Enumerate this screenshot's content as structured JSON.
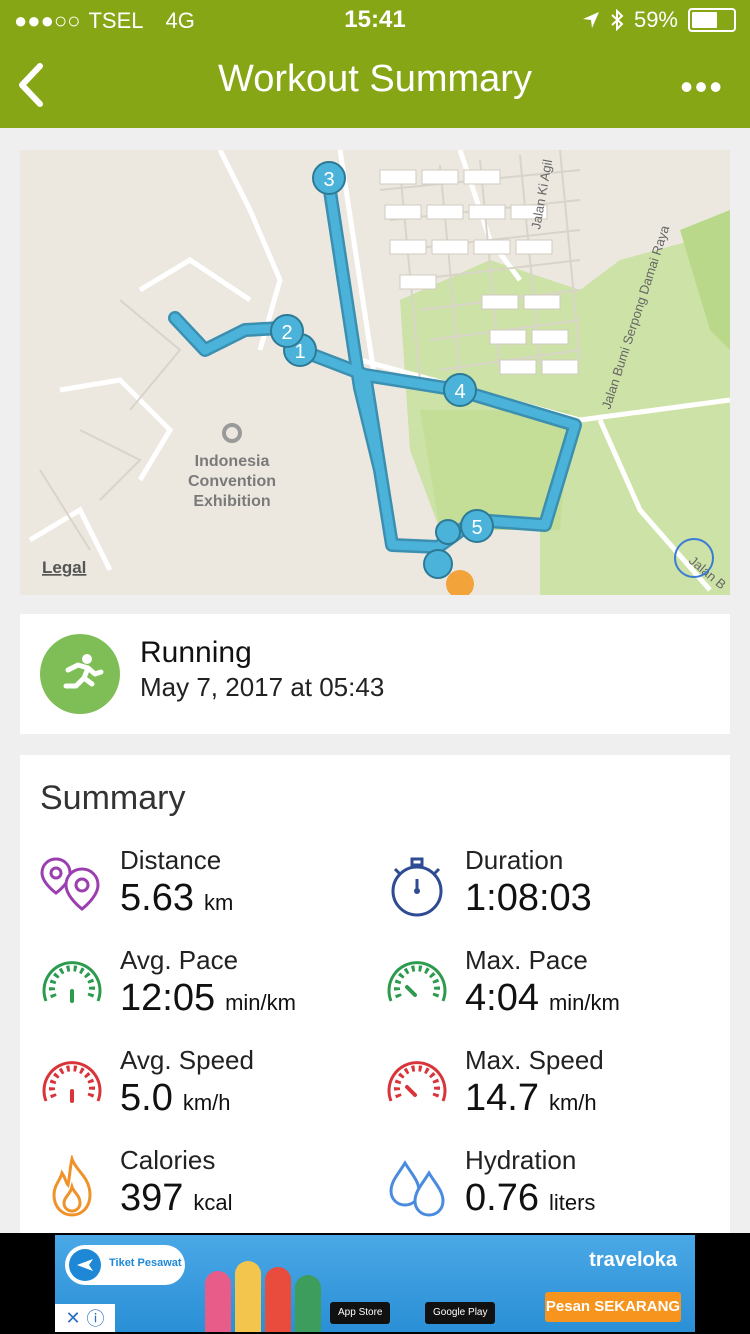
{
  "status_bar": {
    "carrier": "TSEL",
    "network": "4G",
    "time": "15:41",
    "battery": "59%",
    "battery_level": 0.59,
    "signal_dots": "●●●○○"
  },
  "nav": {
    "title": "Workout Summary",
    "back_icon": "chevron-left-icon",
    "more_label": "•••"
  },
  "map": {
    "legal": "Legal",
    "poi_label": [
      "Indonesia",
      "Convention",
      "Exhibition"
    ],
    "road_1": "Jalan Ki Agil",
    "road_2": "Jalan Bumi Serpong Damai Raya",
    "road_3": "Jalan B",
    "markers": [
      "1",
      "2",
      "3",
      "4",
      "5"
    ]
  },
  "activity": {
    "icon": "running-icon",
    "type": "Running",
    "date": "May 7, 2017 at 05:43",
    "color": "#7fbe56"
  },
  "summary": {
    "title": "Summary",
    "metrics": [
      {
        "label": "Distance",
        "value": "5.63",
        "unit": "km",
        "icon": "location-pins-icon"
      },
      {
        "label": "Duration",
        "value": "1:08:03",
        "unit": "",
        "icon": "stopwatch-icon"
      },
      {
        "label": "Avg. Pace",
        "value": "12:05",
        "unit": "min/km",
        "icon": "pace-gauge-icon"
      },
      {
        "label": "Max. Pace",
        "value": "4:04",
        "unit": "min/km",
        "icon": "pace-gauge-icon"
      },
      {
        "label": "Avg. Speed",
        "value": "5.0",
        "unit": "km/h",
        "icon": "speed-gauge-icon"
      },
      {
        "label": "Max. Speed",
        "value": "14.7",
        "unit": "km/h",
        "icon": "speed-gauge-icon"
      },
      {
        "label": "Calories",
        "value": "397",
        "unit": "kcal",
        "icon": "flame-icon"
      },
      {
        "label": "Hydration",
        "value": "0.76",
        "unit": "liters",
        "icon": "water-drops-icon"
      }
    ]
  },
  "ad": {
    "brand": "traveloka",
    "cta": "Pesan SEKARANG",
    "app_store": "App Store",
    "google_play": "Google Play",
    "tiket": "Tiket Pesawat"
  },
  "colors": {
    "accent": "#86a615",
    "route": "#4bb3d9",
    "running": "#7fbe56"
  }
}
